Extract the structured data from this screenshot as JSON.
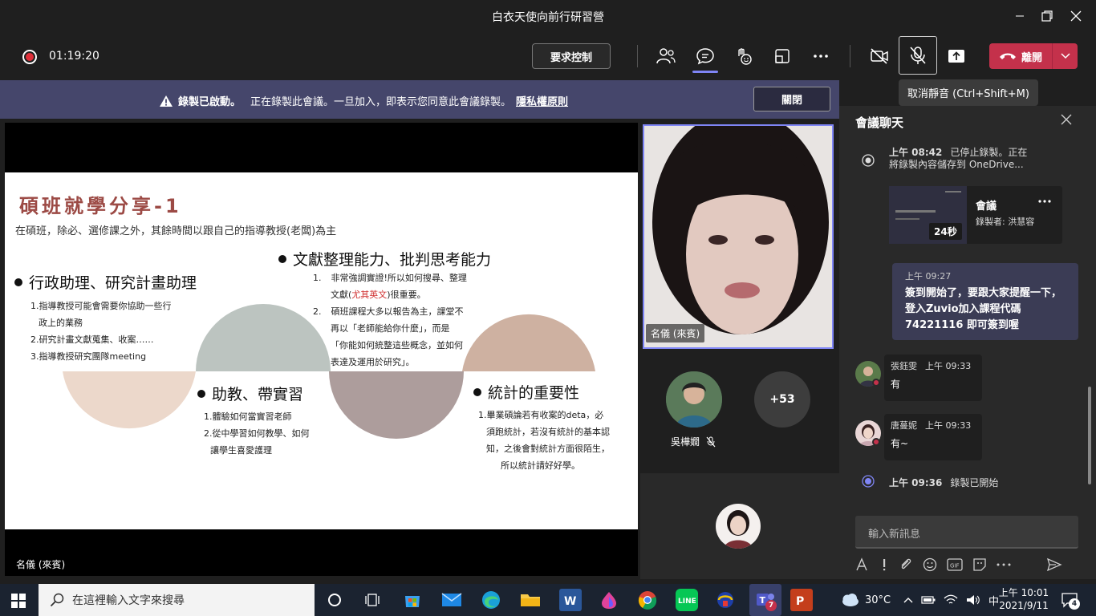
{
  "window": {
    "title": "白衣天使向前行研習營"
  },
  "toolbar": {
    "record_time": "01:19:20",
    "request_control_label": "要求控制",
    "leave_label": "離開",
    "mute_tooltip": "取消靜音 (Ctrl+Shift+M)"
  },
  "banner": {
    "label": "錄製已啟動。",
    "text": "正在錄製此會議。一旦加入，即表示您同意此會議錄製。",
    "link": "隱私權原則",
    "close_label": "關閉"
  },
  "slide": {
    "title": "碩班就學分享-1",
    "subtitle": "在碩班，除必、選修課之外，其餘時間以跟自己的指導教授(老闆)為主",
    "h1": "行政助理、研究計畫助理",
    "h1_items": [
      "1.指導教授可能會需要你協助一些行",
      "政上的業務",
      "2.研究計畫文獻蒐集、收案……",
      "3.指導教授研究團隊meeting"
    ],
    "h2": "文獻整理能力、批判思考能力",
    "h2_item1_num": "1.",
    "h2_item1_a": "非常強調實證!所以如何搜尋、整理",
    "h2_item1_b_pre": "文獻(",
    "h2_item1_b_red": "尤其英文",
    "h2_item1_b_post": ")很重要。",
    "h2_item2_num": "2.",
    "h2_item2_lines": [
      "碩班課程大多以報告為主，課堂不",
      "再以「老師能給你什麼」，而是",
      "「你能如何統整這些概念，並如何",
      "表達及運用於研究」。"
    ],
    "h3": "助教、帶實習",
    "h3_items": [
      "1.體驗如何當實習老師",
      "2.從中學習如何教學、如何",
      "讓學生喜愛護理"
    ],
    "h4": "統計的重要性",
    "h4_items": [
      "1.畢業碩論若有收案的deta，必",
      "須跑統計，若沒有統計的基本認",
      "知，之後會對統計方面很陌生，",
      "所以統計請好好學。"
    ],
    "colors": {
      "sage": "#bcc4c0",
      "blush": "#ecd8cb",
      "taupe": "#ad9d9c",
      "rose": "#ceb1a1",
      "title": "#9c4a45"
    }
  },
  "stage": {
    "presenter_label": "名儀 (來賓)"
  },
  "participants": {
    "self_label": "名儀 (來賓)",
    "p1_name": "吳樺嫺",
    "more_count": "+53"
  },
  "chat": {
    "title": "會議聊天",
    "sys1_time": "上午 08:42",
    "sys1_text_a": "已停止錄製。正在",
    "sys1_text_b": "將錄製內容儲存到 OneDrive...",
    "rec_card_title": "會議",
    "rec_card_sub": "錄製者: 洪慧容",
    "rec_card_duration": "24秒",
    "self_msg_time": "上午 09:27",
    "self_msg_lines": [
      "簽到開始了，要跟大家提醒一下，",
      "登入Zuvio加入課程代碼",
      "74221116 即可簽到喔"
    ],
    "m1_name": "張鈺雯",
    "m1_time": "上午 09:33",
    "m1_body": "有",
    "m2_name": "唐蔓妮",
    "m2_time": "上午 09:33",
    "m2_body": "有~",
    "sys2_time": "上午 09:36",
    "sys2_text": "錄製已開始",
    "input_placeholder": "輸入新訊息"
  },
  "taskbar": {
    "search_placeholder": "在這裡輸入文字來搜尋",
    "weather": "30°C",
    "ime": "中",
    "time": "上午 10:01",
    "date": "2021/9/11",
    "teams_badge": "7",
    "notif_count": "4"
  },
  "icons": [
    "record-icon",
    "people-icon",
    "chat-icon",
    "reactions-icon",
    "rooms-icon",
    "more-icon",
    "camera-off-icon",
    "mic-off-icon",
    "share-icon",
    "phone-icon",
    "warning-icon",
    "close-icon",
    "windows-icon",
    "search-icon",
    "cortana-icon",
    "taskview-icon",
    "store-icon",
    "mail-icon",
    "edge-icon",
    "explorer-icon",
    "word-icon",
    "chrome-icon",
    "line-icon",
    "teams-icon",
    "powerpoint-icon",
    "weather-icon",
    "wifi-icon",
    "volume-icon",
    "notification-icon"
  ]
}
